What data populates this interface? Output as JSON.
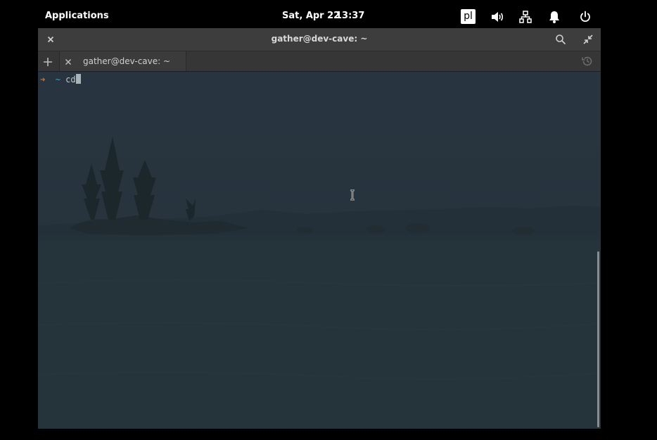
{
  "panel": {
    "applications_label": "Applications",
    "date": "Sat, Apr 22",
    "time": "13:37",
    "keyboard_layout": "pl",
    "icons": [
      "volume-icon",
      "network-icon",
      "notifications-icon",
      "power-icon"
    ]
  },
  "window": {
    "title": "gather@dev-cave: ~",
    "tabs": [
      {
        "label": "gather@dev-cave: ~"
      }
    ]
  },
  "terminal": {
    "prompt_arrow": "➜",
    "prompt_dir": "~",
    "command": "cd"
  },
  "colors": {
    "prompt_arrow": "#c8773a",
    "prompt_dir": "#3fa7b7",
    "terminal_bg": "#27333d"
  }
}
